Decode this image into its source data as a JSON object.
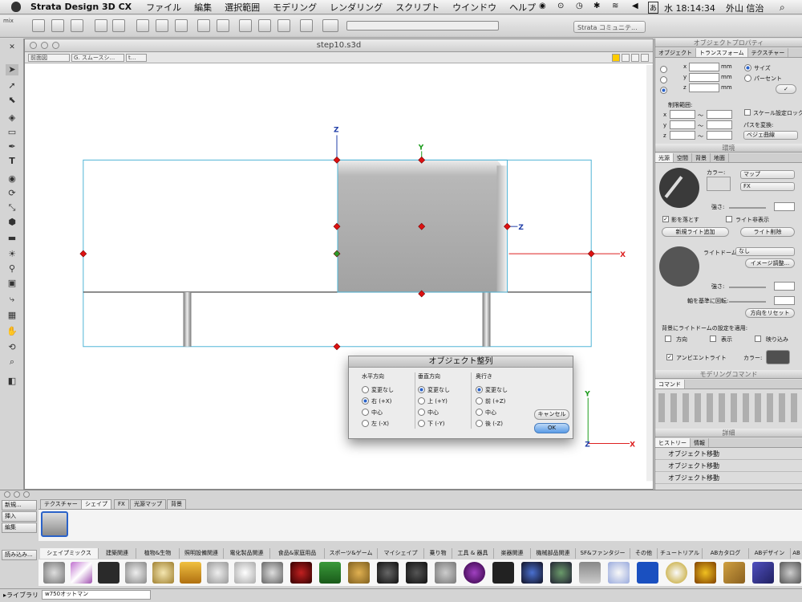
{
  "menubar": {
    "app_name": "Strata Design 3D CX",
    "items": [
      "ファイル",
      "編集",
      "選択範囲",
      "モデリング",
      "レンダリング",
      "スクリプト",
      "ウインドウ",
      "ヘルプ"
    ],
    "input_method": "あ",
    "clock": "水 18:14:34",
    "user": "外山 信治"
  },
  "toolbar": {
    "mix_label": "mix",
    "strata_community": "Strata コミュニテ..."
  },
  "document": {
    "title": "step10.s3d",
    "view_select": "前面図",
    "render_select": "G. スムースシ...",
    "render_select2": "t..."
  },
  "axes": {
    "x": "X",
    "y": "Y",
    "z": "Z"
  },
  "object_properties": {
    "title": "オブジェクトプロパティ",
    "tabs": [
      "オブジェクト",
      "トランスフォーム",
      "テクスチャー"
    ],
    "active_tab": 1,
    "fields": [
      "x",
      "y",
      "z"
    ],
    "unit": "mm",
    "size_label": "サイズ",
    "percent_label": "パーセント",
    "limit_label": "制限範囲:",
    "range_sep": "～",
    "scale_lock": "スケール設定ロック",
    "path_convert": "パスを変換:",
    "path_select": "ベジェ曲線"
  },
  "environment": {
    "title": "環境",
    "tabs": [
      "光源",
      "空間",
      "背景",
      "地面"
    ],
    "color_label": "カラー:",
    "map_select": "マップ",
    "fx_select": "FX",
    "intensity_label": "強さ:",
    "cast_shadow": "影を落とす",
    "hide_light": "ライト非表示",
    "add_light": "新規ライト追加",
    "delete_light": "ライト削除",
    "light_dome_label": "ライトドーム:",
    "light_dome_select": "なし",
    "image_adjust": "イメージ調整...",
    "rotate_axis": "軸を基準に回転:",
    "reset_direction": "方向をリセット",
    "apply_label": "背景にライトドームの設定を適用:",
    "apply_direction": "方向",
    "apply_display": "表示",
    "apply_reflect": "映り込み",
    "ambient_light": "アンビエントライト",
    "ambient_color_label": "カラー:"
  },
  "modeling_command": {
    "title": "モデリングコマンド",
    "tab": "コマンド"
  },
  "details": {
    "title": "詳細",
    "tabs": [
      "ヒストリー",
      "情報"
    ],
    "history": [
      "オブジェクト移動",
      "オブジェクト移動",
      "オブジェクト移動"
    ]
  },
  "align_dialog": {
    "title": "オブジェクト整列",
    "columns": [
      {
        "label": "水平方向",
        "options": [
          "変更なし",
          "右 (+X)",
          "中心",
          "左 (-X)"
        ],
        "selected": 1
      },
      {
        "label": "垂直方向",
        "options": [
          "変更なし",
          "上 (+Y)",
          "中心",
          "下 (-Y)"
        ],
        "selected": 0
      },
      {
        "label": "奥行き",
        "options": [
          "変更なし",
          "前 (+Z)",
          "中心",
          "後 (-Z)"
        ],
        "selected": 0
      }
    ],
    "cancel": "キャンセル",
    "ok": "OK"
  },
  "resource_palette": {
    "buttons": [
      "新規...",
      "挿入",
      "編集"
    ],
    "tabs": [
      "テクスチャー",
      "シェイプ",
      "FX",
      "光源マップ",
      "背景"
    ],
    "active_tab": 1,
    "load_button": "読み込み...",
    "categories": [
      "シェイプミックス",
      "建築関連",
      "植物&生物",
      "照明設備関連",
      "電化製品関連",
      "食品&家庭用品",
      "スポーツ&ゲーム",
      "マイシェイプ",
      "乗り物",
      "工具 & 器具",
      "楽器関連",
      "機械部品関連",
      "SF&ファンタジー",
      "その他",
      "チュートリアル",
      "ABカタログ",
      "ABデザイン",
      "AB"
    ],
    "active_category": 0,
    "library_label": "ライブラリ",
    "library_select": "w750オットマン"
  }
}
